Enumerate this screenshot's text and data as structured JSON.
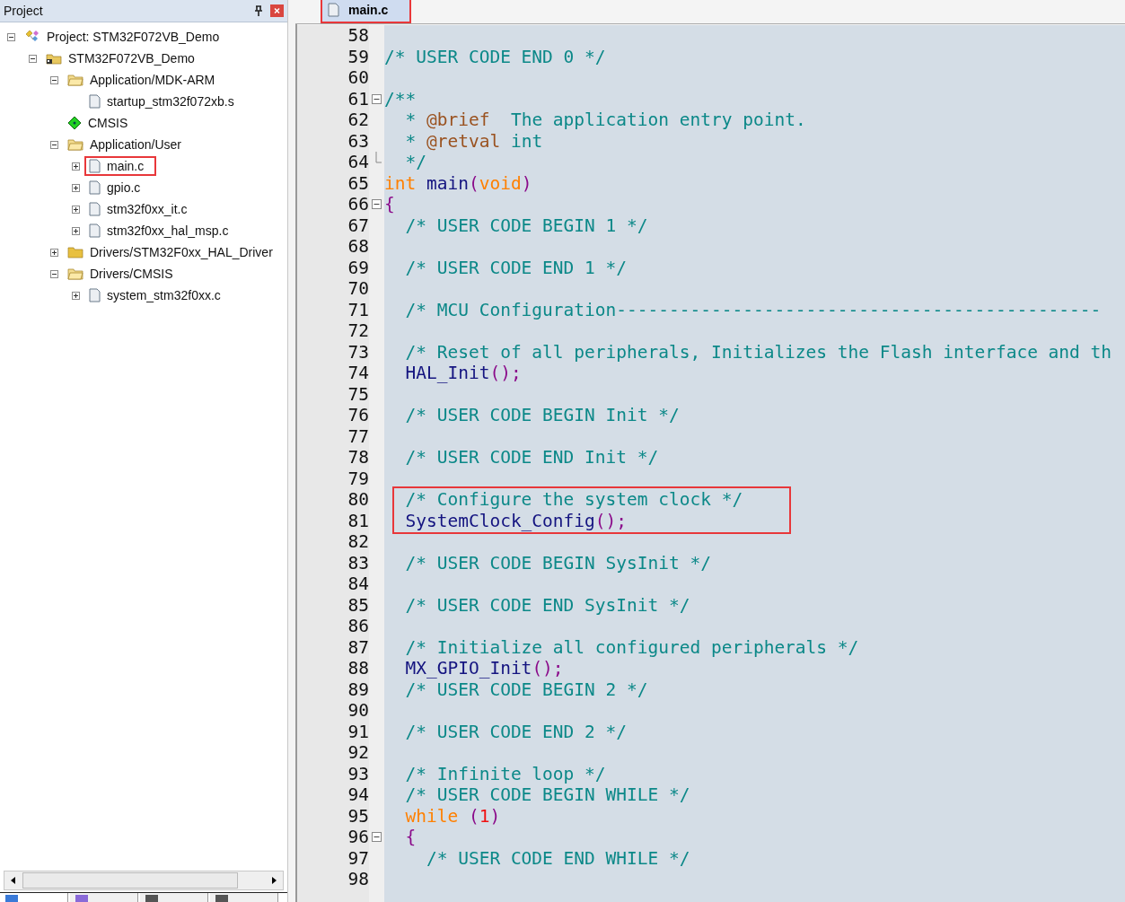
{
  "project_panel": {
    "title": "Project",
    "tree": [
      {
        "label": "Project: STM32F072VB_Demo",
        "kind": "project",
        "expanded": true,
        "children": [
          {
            "label": "STM32F072VB_Demo",
            "kind": "target",
            "expanded": true,
            "children": [
              {
                "label": "Application/MDK-ARM",
                "kind": "folder",
                "expanded": true,
                "children": [
                  {
                    "label": "startup_stm32f072xb.s",
                    "kind": "file"
                  }
                ]
              },
              {
                "label": "CMSIS",
                "kind": "component"
              },
              {
                "label": "Application/User",
                "kind": "folder",
                "expanded": true,
                "children": [
                  {
                    "label": "main.c",
                    "kind": "file",
                    "expanded": false,
                    "boxed": true
                  },
                  {
                    "label": "gpio.c",
                    "kind": "file",
                    "expanded": false
                  },
                  {
                    "label": "stm32f0xx_it.c",
                    "kind": "file",
                    "expanded": false
                  },
                  {
                    "label": "stm32f0xx_hal_msp.c",
                    "kind": "file",
                    "expanded": false
                  }
                ]
              },
              {
                "label": "Drivers/STM32F0xx_HAL_Driver",
                "kind": "folder",
                "expanded": false
              },
              {
                "label": "Drivers/CMSIS",
                "kind": "folder",
                "expanded": true,
                "children": [
                  {
                    "label": "system_stm32f0xx.c",
                    "kind": "file",
                    "expanded": false
                  }
                ]
              }
            ]
          }
        ]
      }
    ],
    "bottom_tabs": [
      {
        "selected": true
      },
      {
        "selected": false
      },
      {
        "selected": false
      },
      {
        "selected": false
      }
    ]
  },
  "editor": {
    "tabs": [
      {
        "label": "main.c",
        "selected": true,
        "boxed": true
      }
    ],
    "lines": [
      {
        "number": "58"
      },
      {
        "number": "59",
        "tokens": [
          {
            "kind": "comment",
            "text": "/* USER CODE END 0 */"
          }
        ]
      },
      {
        "number": "60"
      },
      {
        "number": "61",
        "kind": "foldstart",
        "tokens": [
          {
            "kind": "comment",
            "text": "/**"
          }
        ]
      },
      {
        "number": "62",
        "tokens": [
          {
            "kind": "comment",
            "text": "  * "
          },
          {
            "kind": "doctag",
            "text": "@brief"
          },
          {
            "kind": "comment",
            "text": "  The application entry point."
          }
        ]
      },
      {
        "number": "63",
        "tokens": [
          {
            "kind": "comment",
            "text": "  * "
          },
          {
            "kind": "doctag",
            "text": "@retval"
          },
          {
            "kind": "comment",
            "text": " int"
          }
        ]
      },
      {
        "number": "64",
        "kind": "foldend",
        "tokens": [
          {
            "kind": "comment",
            "text": "  */"
          }
        ]
      },
      {
        "number": "65",
        "tokens": [
          {
            "kind": "keyword",
            "text": "int"
          },
          {
            "kind": "func",
            "text": " main"
          },
          {
            "kind": "punct",
            "text": "("
          },
          {
            "kind": "keyword",
            "text": "void"
          },
          {
            "kind": "punct",
            "text": ")"
          }
        ]
      },
      {
        "number": "66",
        "kind": "foldstart",
        "tokens": [
          {
            "kind": "punct",
            "text": "{"
          }
        ]
      },
      {
        "number": "67",
        "tokens": [
          {
            "kind": "comment",
            "text": "  /* USER CODE BEGIN 1 */"
          }
        ]
      },
      {
        "number": "68"
      },
      {
        "number": "69",
        "tokens": [
          {
            "kind": "comment",
            "text": "  /* USER CODE END 1 */"
          }
        ]
      },
      {
        "number": "70"
      },
      {
        "number": "71",
        "tokens": [
          {
            "kind": "comment",
            "text": "  /* MCU Configuration----------------------------------------------"
          }
        ]
      },
      {
        "number": "72"
      },
      {
        "number": "73",
        "tokens": [
          {
            "kind": "comment",
            "text": "  /* Reset of all peripherals, Initializes the Flash interface and th"
          }
        ]
      },
      {
        "number": "74",
        "tokens": [
          {
            "kind": "func",
            "text": "  HAL_Init"
          },
          {
            "kind": "punct",
            "text": "();"
          }
        ]
      },
      {
        "number": "75"
      },
      {
        "number": "76",
        "tokens": [
          {
            "kind": "comment",
            "text": "  /* USER CODE BEGIN Init */"
          }
        ]
      },
      {
        "number": "77"
      },
      {
        "number": "78",
        "tokens": [
          {
            "kind": "comment",
            "text": "  /* USER CODE END Init */"
          }
        ]
      },
      {
        "number": "79"
      },
      {
        "number": "80",
        "boxed": true,
        "tokens": [
          {
            "kind": "comment",
            "text": "  /* Configure the system clock */"
          }
        ]
      },
      {
        "number": "81",
        "boxed": true,
        "tokens": [
          {
            "kind": "func",
            "text": "  SystemClock_Config"
          },
          {
            "kind": "punct",
            "text": "();"
          }
        ]
      },
      {
        "number": "82"
      },
      {
        "number": "83",
        "tokens": [
          {
            "kind": "comment",
            "text": "  /* USER CODE BEGIN SysInit */"
          }
        ]
      },
      {
        "number": "84"
      },
      {
        "number": "85",
        "tokens": [
          {
            "kind": "comment",
            "text": "  /* USER CODE END SysInit */"
          }
        ]
      },
      {
        "number": "86"
      },
      {
        "number": "87",
        "tokens": [
          {
            "kind": "comment",
            "text": "  /* Initialize all configured peripherals */"
          }
        ]
      },
      {
        "number": "88",
        "tokens": [
          {
            "kind": "func",
            "text": "  MX_GPIO_Init"
          },
          {
            "kind": "punct",
            "text": "();"
          }
        ]
      },
      {
        "number": "89",
        "tokens": [
          {
            "kind": "comment",
            "text": "  /* USER CODE BEGIN 2 */"
          }
        ]
      },
      {
        "number": "90"
      },
      {
        "number": "91",
        "tokens": [
          {
            "kind": "comment",
            "text": "  /* USER CODE END 2 */"
          }
        ]
      },
      {
        "number": "92"
      },
      {
        "number": "93",
        "tokens": [
          {
            "kind": "comment",
            "text": "  /* Infinite loop */"
          }
        ]
      },
      {
        "number": "94",
        "tokens": [
          {
            "kind": "comment",
            "text": "  /* USER CODE BEGIN WHILE */"
          }
        ]
      },
      {
        "number": "95",
        "tokens": [
          {
            "kind": "keyword",
            "text": "  while"
          },
          {
            "kind": "punct",
            "text": " ("
          },
          {
            "kind": "number",
            "text": "1"
          },
          {
            "kind": "punct",
            "text": ")"
          }
        ]
      },
      {
        "number": "96",
        "kind": "foldstart",
        "tokens": [
          {
            "kind": "punct",
            "text": "  {"
          }
        ]
      },
      {
        "number": "97",
        "tokens": [
          {
            "kind": "comment",
            "text": "    /* USER CODE END WHILE */"
          }
        ]
      },
      {
        "number": "98"
      }
    ]
  }
}
